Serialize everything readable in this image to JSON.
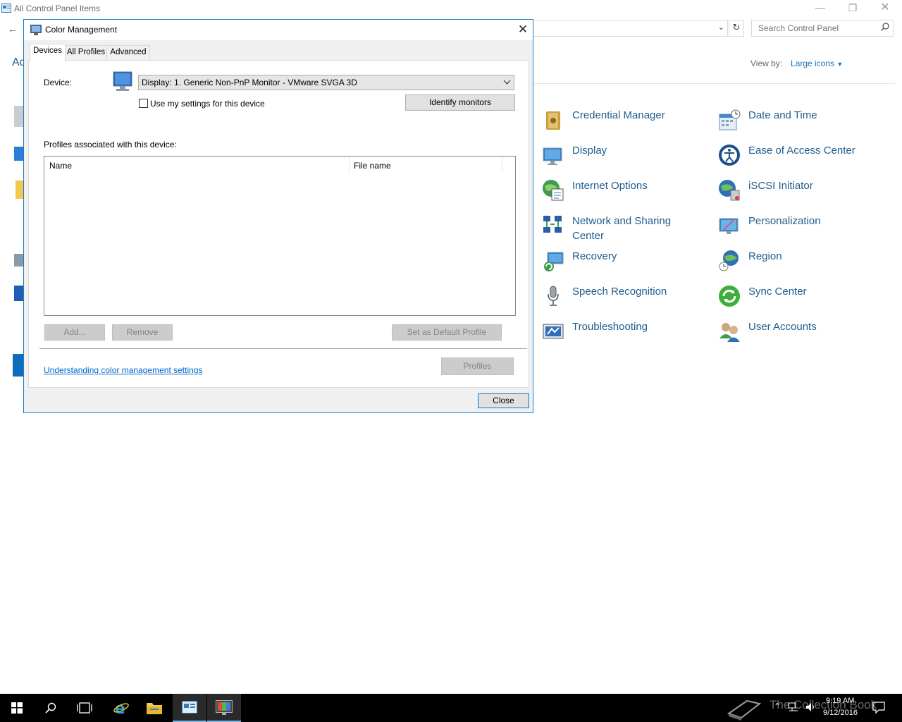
{
  "control_panel": {
    "title": "All Control Panel Items",
    "search_placeholder": "Search Control Panel",
    "view_by_label": "View by:",
    "view_by_value": "Large icons",
    "partial_header": "Ac",
    "items": [
      {
        "label": "Credential Manager",
        "icon": "credential-manager-icon"
      },
      {
        "label": "Date and Time",
        "icon": "date-time-icon"
      },
      {
        "label": "Display",
        "icon": "display-icon"
      },
      {
        "label": "Ease of Access Center",
        "icon": "ease-of-access-icon"
      },
      {
        "label": "Internet Options",
        "icon": "internet-options-icon"
      },
      {
        "label": "iSCSI Initiator",
        "icon": "iscsi-icon"
      },
      {
        "label": "Network and Sharing Center",
        "icon": "network-sharing-icon"
      },
      {
        "label": "Personalization",
        "icon": "personalization-icon"
      },
      {
        "label": "Recovery",
        "icon": "recovery-icon"
      },
      {
        "label": "Region",
        "icon": "region-icon"
      },
      {
        "label": "Speech Recognition",
        "icon": "speech-recognition-icon"
      },
      {
        "label": "Sync Center",
        "icon": "sync-center-icon"
      },
      {
        "label": "Troubleshooting",
        "icon": "troubleshooting-icon"
      },
      {
        "label": "User Accounts",
        "icon": "user-accounts-icon"
      }
    ]
  },
  "dialog": {
    "title": "Color Management",
    "tabs": [
      "Devices",
      "All Profiles",
      "Advanced"
    ],
    "device_label": "Device:",
    "device_value": "Display: 1. Generic Non-PnP Monitor - VMware SVGA 3D",
    "use_my_settings": "Use my settings for this device",
    "identify_monitors": "Identify monitors",
    "profiles_label": "Profiles associated with this device:",
    "columns": [
      "Name",
      "File name"
    ],
    "add_button": "Add...",
    "remove_button": "Remove",
    "set_default_button": "Set as Default Profile",
    "help_link": "Understanding color management settings",
    "profiles_button": "Profiles",
    "close_button": "Close"
  },
  "taskbar": {
    "time": "9:19 AM",
    "date": "9/12/2016",
    "watermark": "The Collection Book"
  },
  "colors": {
    "accent": "#1a7ec8",
    "link": "#0066cc",
    "cp_link": "#1f5c8c"
  }
}
